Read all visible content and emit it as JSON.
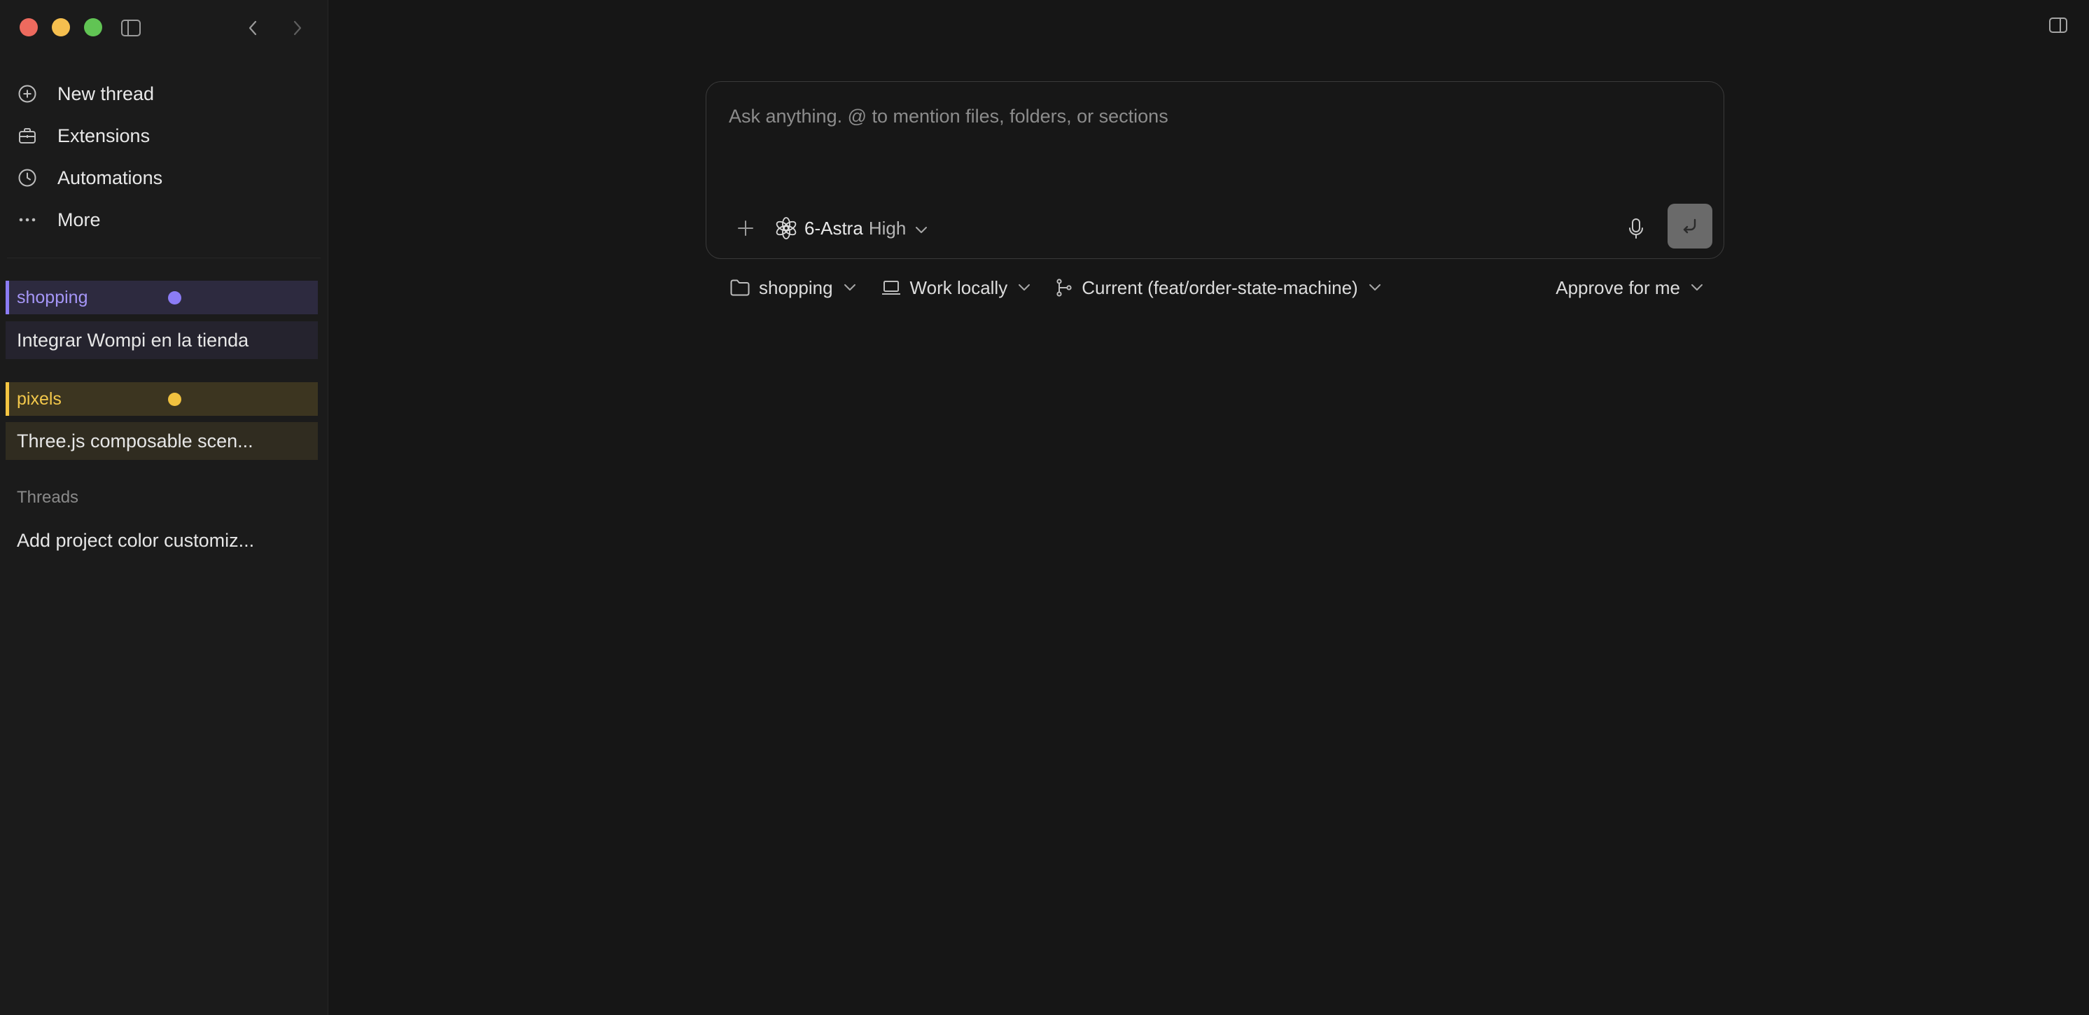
{
  "window": {
    "controls": [
      "close",
      "minimize",
      "zoom"
    ]
  },
  "sidebar": {
    "nav": [
      {
        "label": "New thread",
        "icon": "plus-circle-icon"
      },
      {
        "label": "Extensions",
        "icon": "briefcase-icon"
      },
      {
        "label": "Automations",
        "icon": "clock-icon"
      },
      {
        "label": "More",
        "icon": "ellipsis-icon"
      }
    ],
    "projects": [
      {
        "name": "shopping",
        "color": "#8b7cf6",
        "thread": "Integrar Wompi en la tienda"
      },
      {
        "name": "pixels",
        "color": "#f5c542",
        "thread": "Three.js composable scen..."
      }
    ],
    "threads_label": "Threads",
    "threads": [
      "Add project color customiz..."
    ]
  },
  "composer": {
    "placeholder": "Ask anything. @ to mention files, folders, or sections",
    "model_name": "6-Astra",
    "model_level": "High"
  },
  "toolbar": {
    "project": "shopping",
    "environment": "Work locally",
    "branch": "Current (feat/order-state-machine)",
    "approval": "Approve for me"
  },
  "colors": {
    "background": "#161616",
    "sidebar": "#1b1b1b",
    "shopping_accent": "#8b7cf6",
    "pixels_accent": "#f5c542"
  }
}
